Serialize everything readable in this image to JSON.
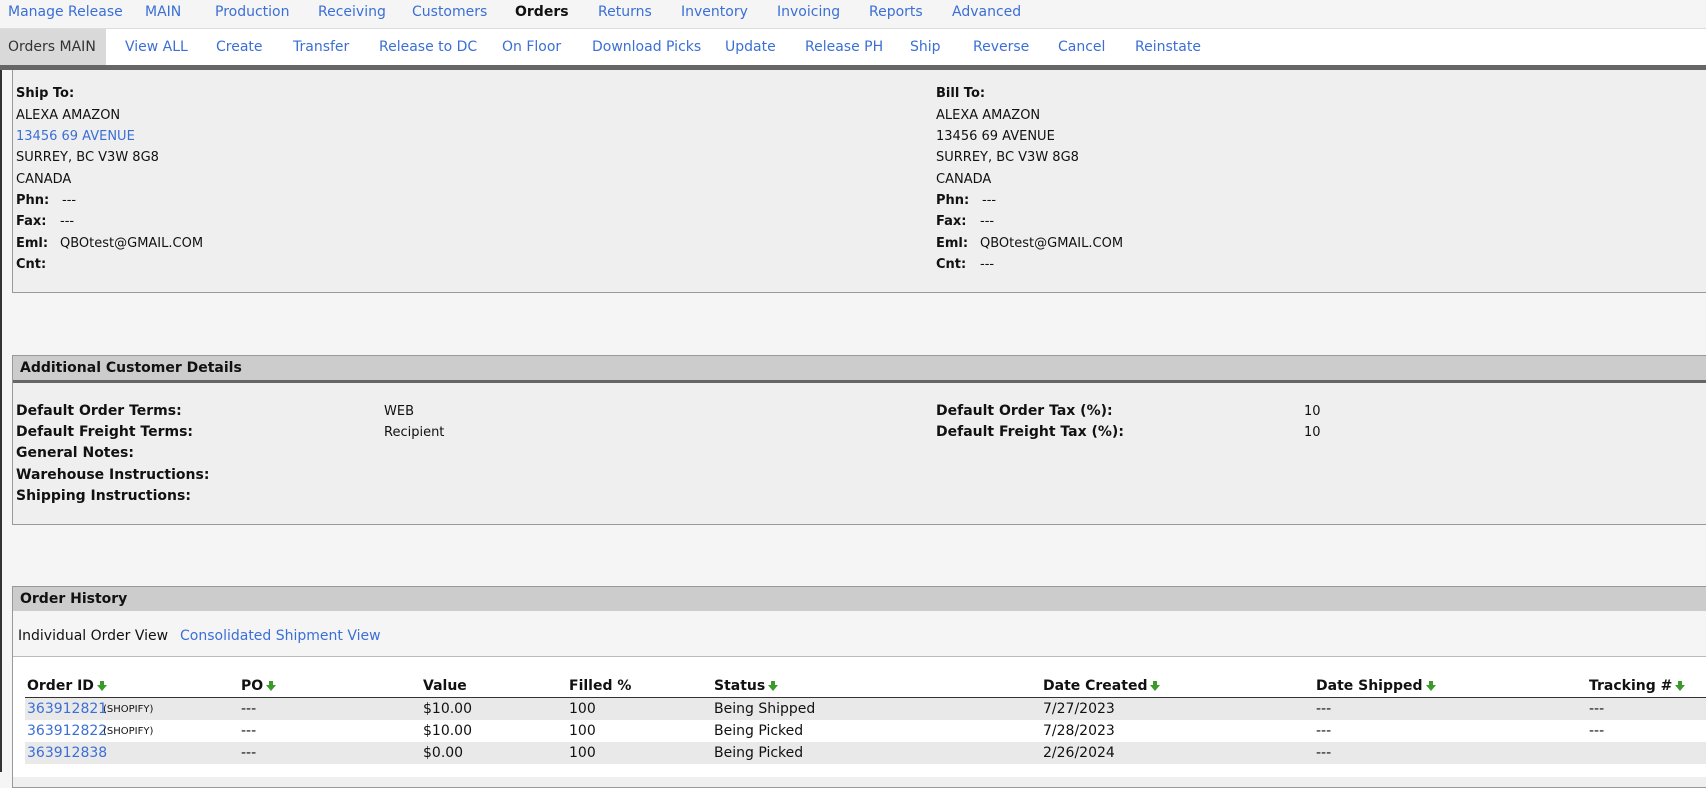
{
  "nav_main": {
    "items": [
      "Manage Release",
      "MAIN",
      "Production",
      "Receiving",
      "Customers",
      "Orders",
      "Returns",
      "Inventory",
      "Invoicing",
      "Reports",
      "Advanced"
    ],
    "active": "Orders"
  },
  "nav_sub": {
    "items": [
      "Orders MAIN",
      "View ALL",
      "Create",
      "Transfer",
      "Release to DC",
      "On Floor",
      "Download Picks",
      "Update",
      "Release PH",
      "Ship",
      "Reverse",
      "Cancel",
      "Reinstate"
    ],
    "active": "Orders MAIN"
  },
  "ship_to": {
    "title": "Ship To:",
    "name": "ALEXA AMAZON",
    "street": "13456 69 AVENUE",
    "city_line": "SURREY, BC  V3W 8G8",
    "country": "CANADA",
    "phn_label": "Phn:",
    "phn": "---",
    "fax_label": "Fax:",
    "fax": "---",
    "eml_label": "Eml:",
    "eml": "QBOtest@GMAIL.COM",
    "cnt_label": "Cnt:",
    "cnt": ""
  },
  "bill_to": {
    "title": "Bill To:",
    "name": "ALEXA AMAZON",
    "street": "13456 69 AVENUE",
    "city_line": "SURREY, BC  V3W 8G8",
    "country": "CANADA",
    "phn_label": "Phn:",
    "phn": "---",
    "fax_label": "Fax:",
    "fax": "---",
    "eml_label": "Eml:",
    "eml": "QBOtest@GMAIL.COM",
    "cnt_label": "Cnt:",
    "cnt": "---"
  },
  "additional": {
    "title": "Additional Customer Details",
    "order_terms_label": "Default Order Terms:",
    "order_terms": "WEB",
    "freight_terms_label": "Default Freight Terms:",
    "freight_terms": "Recipient",
    "general_notes_label": "General Notes:",
    "warehouse_label": "Warehouse Instructions:",
    "shipping_label": "Shipping Instructions:",
    "order_tax_label": "Default Order Tax (%):",
    "order_tax": "10",
    "freight_tax_label": "Default Freight Tax (%):",
    "freight_tax": "10"
  },
  "history": {
    "title": "Order History",
    "view_individual": "Individual Order View",
    "view_consolidated": "Consolidated Shipment View",
    "columns": [
      "Order ID",
      "PO",
      "Value",
      "Filled %",
      "Status",
      "Date Created",
      "Date Shipped",
      "Tracking #"
    ],
    "rows": [
      {
        "order_id": "363912821",
        "source": "(SHOPIFY)",
        "po": "---",
        "value": "$10.00",
        "filled": "100",
        "status": "Being Shipped",
        "created": "7/27/2023",
        "shipped": "---",
        "tracking": "---"
      },
      {
        "order_id": "363912822",
        "source": "(SHOPIFY)",
        "po": "---",
        "value": "$10.00",
        "filled": "100",
        "status": "Being Picked",
        "created": "7/28/2023",
        "shipped": "---",
        "tracking": "---"
      },
      {
        "order_id": "363912838",
        "source": "",
        "po": "---",
        "value": "$0.00",
        "filled": "100",
        "status": "Being Picked",
        "created": "2/26/2024",
        "shipped": "---",
        "tracking": ""
      }
    ]
  },
  "colors": {
    "link": "#3b6fd6",
    "header_bg": "#cccccc",
    "sort_arrow": "#3a9a2a"
  }
}
